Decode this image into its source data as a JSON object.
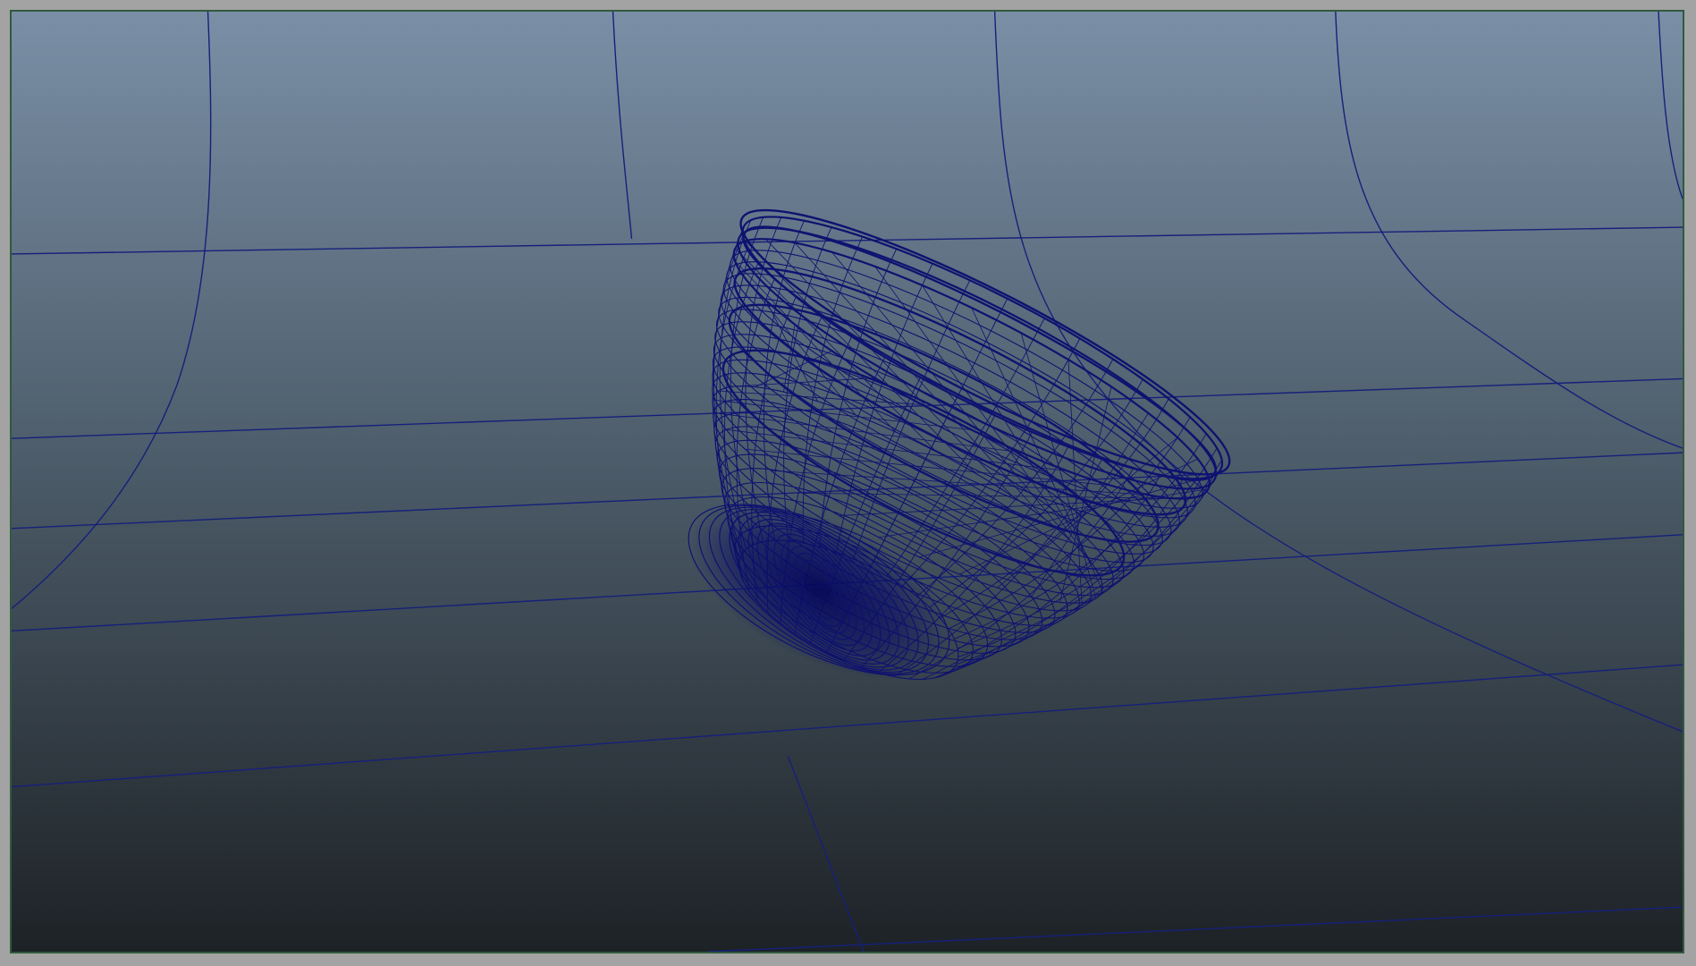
{
  "viewport": {
    "name": "perspective-viewport",
    "display_mode": "wireframe",
    "background_top": "#7a8fa6",
    "background_bottom": "#1d2226",
    "border_color": "#2f5a3e",
    "wire_color": "#0f1270",
    "grid_color": "#16207a"
  },
  "scene": {
    "object": "bowl-mesh",
    "grid": "ground-grid"
  }
}
